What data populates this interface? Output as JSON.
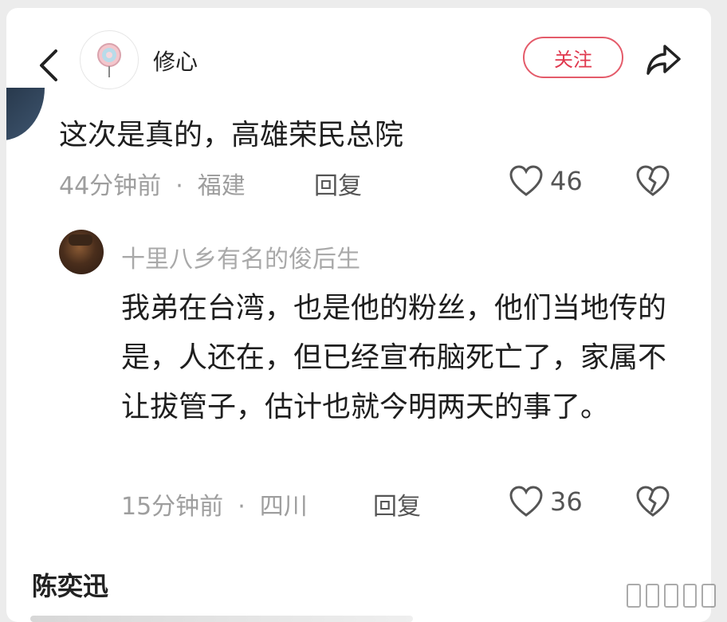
{
  "header": {
    "author_name": "修心",
    "follow_label": "关注"
  },
  "comment": {
    "text": "这次是真的，高雄荣民总院",
    "time": "44分钟前",
    "separator": "·",
    "location": "福建",
    "reply_label": "回复",
    "likes": "46"
  },
  "reply": {
    "username": "十里八乡有名的俊后生",
    "text": "我弟在台湾，也是他的粉丝，他们当地传的是，人还在，但已经宣布脑死亡了，家属不让拔管子，估计也就今明两天的事了。",
    "time": "15分钟前",
    "separator": "·",
    "location": "四川",
    "reply_label": "回复",
    "likes": "36"
  },
  "next_comment": {
    "username": "陈奕迅"
  },
  "colors": {
    "follow": "#e0384e",
    "meta": "#9e9e9e",
    "text": "#1e1e1e"
  }
}
